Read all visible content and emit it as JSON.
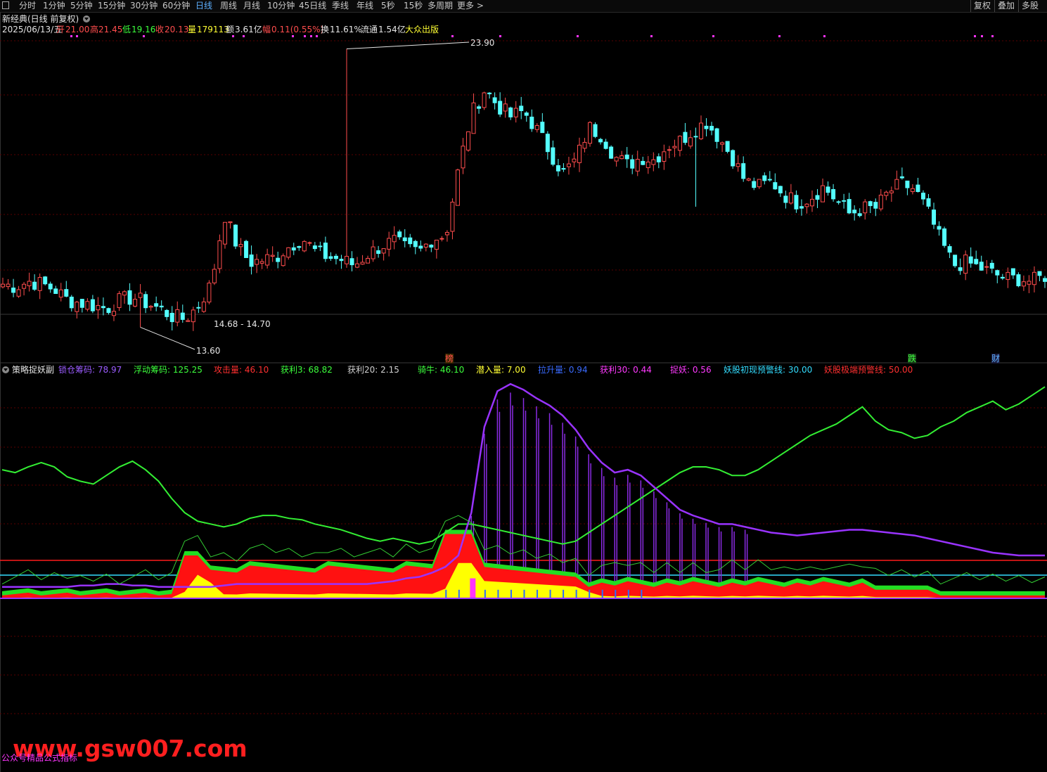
{
  "toolbar": {
    "periods": [
      "分时",
      "1分钟",
      "5分钟",
      "15分钟",
      "30分钟",
      "60分钟",
      "日线",
      "周线",
      "月线",
      "10分钟",
      "45日线",
      "季线",
      "年线",
      "5秒",
      "15秒",
      "多周期",
      "更多 >"
    ],
    "active_period": "日线",
    "right_buttons": [
      "复权",
      "叠加",
      "多股"
    ]
  },
  "stock": {
    "title": "新经典(日线 前复权)",
    "date": "2025/06/13/五",
    "open_label": "开",
    "open": "21.00",
    "high_label": "高",
    "high": "21.45",
    "low_label": "低",
    "low": "19.16",
    "close_label": "收",
    "close": "20.13",
    "vol_label": "量",
    "vol": "179113",
    "amount_label": "额",
    "amount": "3.61亿",
    "change_label": "幅",
    "change": "0.11(0.55%)",
    "turnover_label": "换",
    "turnover": "11.61%",
    "float_label": "流通",
    "float": "1.54亿",
    "publisher": "大众出版"
  },
  "price_chart": {
    "max_label": "23.90",
    "min_label": "13.60",
    "range_label": "14.68 - 14.70",
    "markers": [
      "榜",
      "跌",
      "财"
    ],
    "ylim": [
      12.7,
      24.2
    ]
  },
  "indicator": {
    "name": "策略捉妖副",
    "items": [
      {
        "label": "锁仓筹码:",
        "value": "78.97",
        "color": "#9b5cff"
      },
      {
        "label": "浮动筹码:",
        "value": "125.25",
        "color": "#3cff3c"
      },
      {
        "label": "攻击量:",
        "value": "46.10",
        "color": "#ff3030"
      },
      {
        "label": "获利3:",
        "value": "68.82",
        "color": "#3cff3c"
      },
      {
        "label": "获利20:",
        "value": "2.15",
        "color": "#d0d0d0"
      },
      {
        "label": "骑牛:",
        "value": "46.10",
        "color": "#3cff3c"
      },
      {
        "label": "潜入量:",
        "value": "7.00",
        "color": "#ffff33"
      },
      {
        "label": "拉升量:",
        "value": "0.94",
        "color": "#3a6bff"
      },
      {
        "label": "获利30:",
        "value": "0.44",
        "color": "#ff3aff"
      },
      {
        "label": "捉妖:",
        "value": "0.56",
        "color": "#ff3aff"
      },
      {
        "label": "妖股初现预警线:",
        "value": "30.00",
        "color": "#33ddff"
      },
      {
        "label": "妖股极端预警线:",
        "value": "50.00",
        "color": "#ff3030"
      }
    ]
  },
  "colors": {
    "up": "#ff4d4d",
    "down": "#54ffff",
    "purple": "#9933ff",
    "green": "#33ee33",
    "red": "#ff0000",
    "yellow": "#ffff00",
    "cyan": "#33ddff",
    "magenta": "#ff33ff",
    "grid": "#5a0000"
  },
  "chart_data": [
    {
      "type": "candlestick",
      "title": "新经典(日线 前复权)",
      "ylim": [
        12.7,
        24.2
      ],
      "x": "daily bars (~198 trading days ending 2025/06/13)",
      "ohlc_anchors": [
        {
          "label": "low",
          "value": 13.6
        },
        {
          "label": "high",
          "value": 23.9
        },
        {
          "label": "last close",
          "value": 20.13
        }
      ],
      "close_trajectory": [
        15.2,
        15.1,
        15.3,
        15.2,
        15.0,
        14.6,
        14.5,
        14.4,
        14.3,
        14.6,
        14.7,
        14.5,
        14.3,
        14.0,
        13.9,
        14.4,
        15.2,
        17.8,
        16.6,
        16.0,
        16.1,
        16.2,
        16.6,
        16.9,
        16.4,
        16.2,
        16.1,
        15.9,
        16.3,
        16.6,
        16.8,
        16.5,
        16.4,
        16.9,
        17.0,
        19.5,
        21.5,
        22.4,
        21.8,
        21.4,
        21.6,
        20.9,
        20.1,
        19.3,
        19.8,
        21.0,
        20.7,
        19.9,
        19.6,
        19.9,
        19.8,
        20.3,
        20.5,
        20.9,
        21.2,
        20.6,
        19.9,
        19.0,
        18.8,
        19.0,
        18.5,
        18.2,
        18.4,
        18.8,
        18.3,
        17.8,
        18.0,
        18.0,
        18.6,
        18.9,
        18.7,
        17.9,
        16.8,
        15.9,
        16.0,
        15.8,
        15.6,
        15.4,
        15.4,
        15.3,
        15.5
      ],
      "markers": [
        {
          "label": "榜"
        },
        {
          "label": "跌"
        },
        {
          "label": "财"
        }
      ]
    },
    {
      "type": "line",
      "title": "策略捉妖副",
      "ylim": [
        -50,
        150
      ],
      "series": [
        {
          "name": "锁仓筹码",
          "last": 78.97
        },
        {
          "name": "浮动筹码",
          "last": 125.25
        },
        {
          "name": "攻击量",
          "last": 46.1
        },
        {
          "name": "获利3",
          "last": 68.82
        },
        {
          "name": "获利20",
          "last": 2.15
        },
        {
          "name": "骑牛",
          "last": 46.1
        },
        {
          "name": "潜入量",
          "last": 7.0
        },
        {
          "name": "拉升量",
          "last": 0.94
        },
        {
          "name": "获利30",
          "last": 0.44
        },
        {
          "name": "捉妖",
          "last": 0.56
        },
        {
          "name": "妖股初现预警线",
          "last": 30.0
        },
        {
          "name": "妖股极端预警线",
          "last": 50.0
        }
      ],
      "purple_line": [
        8,
        8,
        8,
        8,
        8,
        8,
        9,
        9,
        10,
        10,
        9,
        9,
        8,
        8,
        8,
        8,
        8,
        9,
        10,
        10,
        10,
        10,
        10,
        10,
        10,
        10,
        10,
        10,
        10,
        11,
        12,
        14,
        15,
        18,
        22,
        30,
        60,
        120,
        145,
        150,
        146,
        140,
        135,
        128,
        118,
        105,
        95,
        88,
        90,
        86,
        78,
        70,
        62,
        58,
        55,
        52,
        52,
        50,
        48,
        46,
        45,
        44,
        45,
        46,
        47,
        48,
        48,
        47,
        46,
        45,
        44,
        42,
        40,
        38,
        36,
        34,
        32,
        31,
        30,
        30,
        30
      ],
      "green_line": [
        90,
        88,
        92,
        95,
        92,
        85,
        82,
        80,
        86,
        92,
        96,
        90,
        82,
        70,
        60,
        54,
        52,
        50,
        52,
        56,
        58,
        58,
        56,
        55,
        52,
        50,
        48,
        45,
        42,
        40,
        42,
        40,
        38,
        40,
        46,
        52,
        52,
        50,
        48,
        46,
        44,
        42,
        40,
        38,
        40,
        46,
        52,
        58,
        64,
        70,
        76,
        82,
        88,
        92,
        92,
        90,
        86,
        86,
        90,
        96,
        102,
        108,
        114,
        118,
        122,
        128,
        134,
        124,
        118,
        116,
        112,
        114,
        120,
        124,
        130,
        134,
        138,
        132,
        136,
        142,
        148
      ],
      "warning_lines": [
        {
          "name": "妖股初现预警线",
          "value": 30.0
        },
        {
          "name": "妖股极端预警线",
          "value": 50.0
        }
      ]
    }
  ],
  "watermark": {
    "site": "www.gsw007.com",
    "caption": "公众号精品公式指标"
  }
}
